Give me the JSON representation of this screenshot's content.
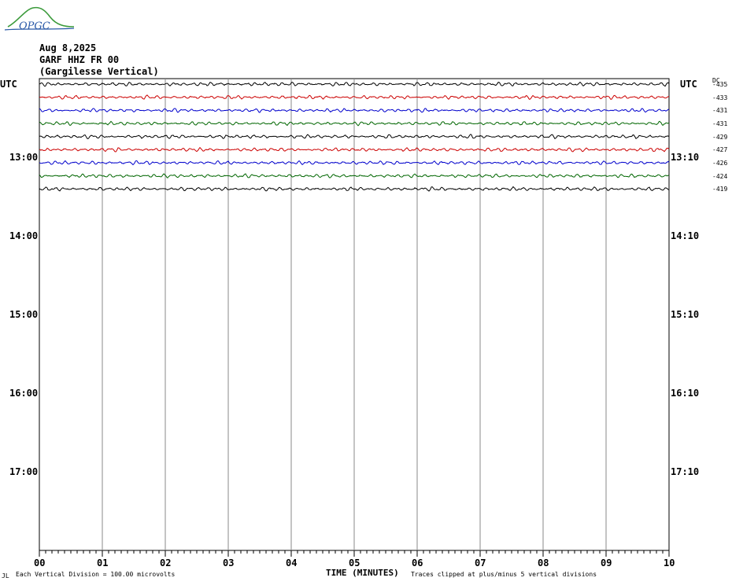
{
  "header": {
    "logo_text": "OPGC",
    "date": "Aug 8,2025",
    "station": "GARF HHZ FR 00",
    "location": "(Gargilesse Vertical)"
  },
  "labels": {
    "utc_left": "UTC",
    "utc_right": "UTC",
    "dc": "DC",
    "time_axis_title": "TIME (MINUTES)",
    "footer_left": "Each Vertical Division =  100.00 microvolts",
    "footer_right": "Traces clipped at plus/minus 5 vertical divisions",
    "footer_mark": "JL"
  },
  "chart_data": {
    "type": "line",
    "title": "GARF HHZ FR 00 (Gargilesse Vertical) Aug 8,2025",
    "xlabel": "TIME (MINUTES)",
    "xlim": [
      0,
      10
    ],
    "x_ticks": [
      "00",
      "01",
      "02",
      "03",
      "04",
      "05",
      "06",
      "07",
      "08",
      "09",
      "10"
    ],
    "left_hour_labels": [
      {
        "label": "13:00",
        "row": 6
      },
      {
        "label": "14:00",
        "row": 12
      },
      {
        "label": "15:00",
        "row": 18
      },
      {
        "label": "16:00",
        "row": 24
      },
      {
        "label": "17:00",
        "row": 30
      }
    ],
    "right_hour_labels": [
      {
        "label": "13:10",
        "row": 6
      },
      {
        "label": "14:10",
        "row": 12
      },
      {
        "label": "15:10",
        "row": 18
      },
      {
        "label": "16:10",
        "row": 24
      },
      {
        "label": "17:10",
        "row": 30
      }
    ],
    "total_rows": 36,
    "colors": [
      "#000000",
      "#cc0000",
      "#0000cc",
      "#006600"
    ],
    "series": [
      {
        "row": 0,
        "color": "#000000",
        "dc": "-435"
      },
      {
        "row": 1,
        "color": "#cc0000",
        "dc": "-433"
      },
      {
        "row": 2,
        "color": "#0000cc",
        "dc": "-431"
      },
      {
        "row": 3,
        "color": "#006600",
        "dc": "-431"
      },
      {
        "row": 4,
        "color": "#000000",
        "dc": "-429"
      },
      {
        "row": 5,
        "color": "#cc0000",
        "dc": "-427"
      },
      {
        "row": 6,
        "color": "#0000cc",
        "dc": "-426"
      },
      {
        "row": 7,
        "color": "#006600",
        "dc": "-424"
      },
      {
        "row": 8,
        "color": "#000000",
        "dc": "-419"
      }
    ],
    "grid": true
  }
}
